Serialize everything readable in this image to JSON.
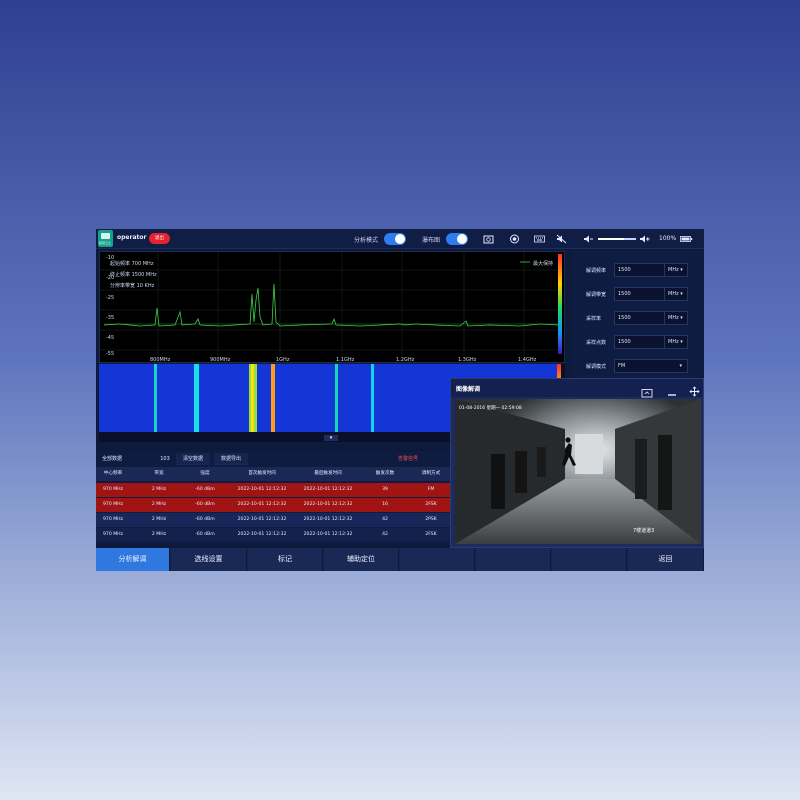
{
  "topbar": {
    "user": "operator",
    "logout": "退出",
    "mode_label": "分析模式",
    "waterfall_label": "瀑布图",
    "battery": "100%",
    "logo_text": "频谱卫士"
  },
  "spectrum": {
    "info": [
      {
        "label": "起始频率",
        "value": "700 MHz"
      },
      {
        "label": "终止频率",
        "value": "1500 MHz"
      },
      {
        "label": "分辨率带宽",
        "value": "10 KHz"
      }
    ],
    "legend": "最大保持",
    "y_ticks": [
      "-10",
      "-20",
      "-25",
      "-35",
      "-45",
      "-55"
    ],
    "x_ticks": [
      "800MHz",
      "900MHz",
      "1GHz",
      "1.1GHz",
      "1.2GHz",
      "1.3GHz",
      "1.4GHz"
    ]
  },
  "table": {
    "all_data": "全部数据",
    "count": "103",
    "clear": "清空数据",
    "export": "数据导出",
    "alarm": "告警信号",
    "headers": [
      "中心频率",
      "带宽",
      "强度",
      "首次触发时间",
      "最后触发时间",
      "触发次数",
      "调制方式"
    ],
    "rows": [
      [
        "970 MHz",
        "2 MHz",
        "-60 dBm",
        "2022-10-01 12:12:32",
        "2022-10-01 12:12:32",
        "39",
        "FM"
      ],
      [
        "970 MHz",
        "2 MHz",
        "-60 dBm",
        "2022-10-01 12:12:32",
        "2022-10-01 12:12:32",
        "16",
        "2FSK"
      ],
      [
        "970 MHz",
        "2 MHz",
        "-60 dBm",
        "2022-10-01 12:12:32",
        "2022-10-01 12:12:32",
        "42",
        "2PSK"
      ],
      [
        "970 MHz",
        "2 MHz",
        "-60 dBm",
        "2022-10-01 12:12:32",
        "2022-10-01 12:12:32",
        "42",
        "2FSK"
      ]
    ]
  },
  "panel": {
    "fields": [
      {
        "label": "解调频率",
        "value": "1500",
        "unit": "MHz"
      },
      {
        "label": "解调带宽",
        "value": "1500",
        "unit": "MHz"
      },
      {
        "label": "采样率",
        "value": "1500",
        "unit": "MHz"
      },
      {
        "label": "采样点数",
        "value": "1500",
        "unit": "MHz"
      }
    ],
    "mode_label": "解调模式",
    "mode_value": "FM"
  },
  "popup": {
    "title": "图像解调",
    "video_time": "01-08-2016 星期一 02:59:08",
    "video_caption": "7楼道道3"
  },
  "bottom": {
    "tabs": [
      "分析解调",
      "选线设置",
      "标记",
      "辅助定位",
      "",
      "",
      "",
      "返回"
    ]
  }
}
